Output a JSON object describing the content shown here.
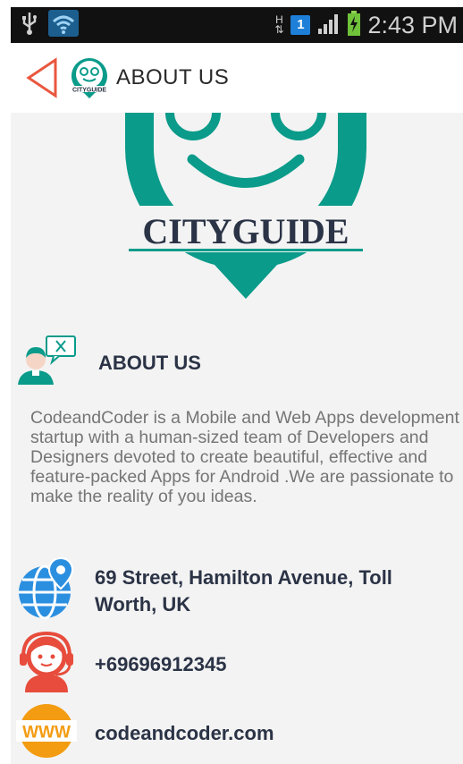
{
  "status_bar": {
    "time": "2:43 PM",
    "badge": "1",
    "h_indicator": "H",
    "icons": [
      "usb-icon",
      "wifi-icon",
      "h-data-icon",
      "notification-badge-icon",
      "signal-icon",
      "battery-charging-icon"
    ]
  },
  "app_bar": {
    "title": "ABOUT US",
    "back_icon": "back-triangle-icon",
    "logo_text": "CITYGUIDE"
  },
  "logo": {
    "text_part1": "CITY",
    "text_part2": "GUIDE",
    "colors": {
      "teal": "#0a9b8a",
      "dark": "#2b3346"
    }
  },
  "about": {
    "heading": "ABOUT US",
    "description": "CodeandCoder is a Mobile and Web Apps development startup with a human-sized team of Developers and Designers devoted to create beautiful, effective and feature-packed Apps for Android .We are passionate to make the reality of you ideas."
  },
  "contact": {
    "address": "69 Street, Hamilton Avenue, Toll Worth, UK",
    "phone": "+69696912345",
    "website": "codeandcoder.com",
    "www_label": "WWW"
  },
  "colors": {
    "accent_orange": "#e9573f",
    "globe_blue": "#2b8fe0",
    "support_red": "#e74c3c",
    "www_orange": "#f39c12",
    "heading_dark": "#2b3346"
  }
}
